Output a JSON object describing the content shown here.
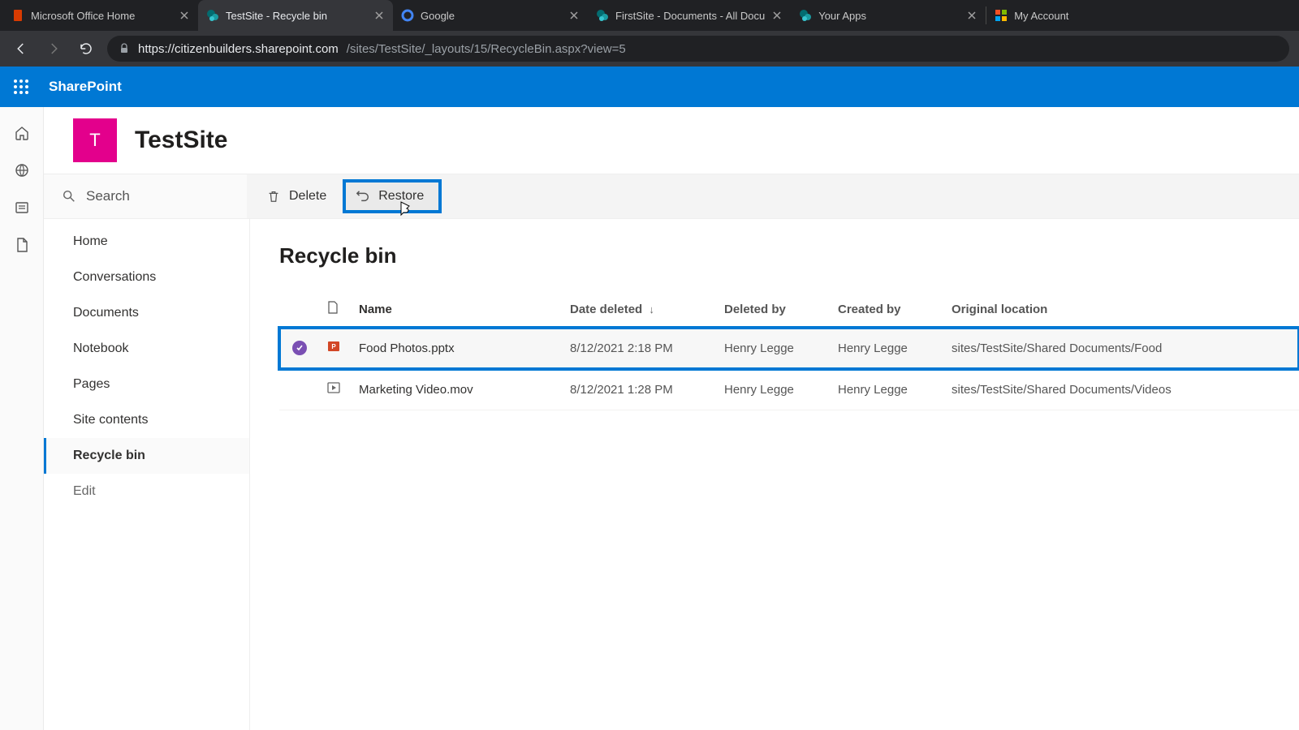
{
  "browser": {
    "tabs": [
      {
        "title": "Microsoft Office Home",
        "favicon": "office"
      },
      {
        "title": "TestSite - Recycle bin",
        "favicon": "sharepoint",
        "active": true
      },
      {
        "title": "Google",
        "favicon": "google"
      },
      {
        "title": "FirstSite - Documents - All Docu",
        "favicon": "sharepoint"
      },
      {
        "title": "Your Apps",
        "favicon": "sharepoint"
      },
      {
        "title": "My Account",
        "favicon": "microsoft"
      }
    ],
    "url_host": "https://citizenbuilders.sharepoint.com",
    "url_path": "/sites/TestSite/_layouts/15/RecycleBin.aspx?view=5"
  },
  "suite": {
    "product": "SharePoint"
  },
  "site": {
    "logo_letter": "T",
    "title": "TestSite"
  },
  "search": {
    "placeholder": "Search"
  },
  "commands": {
    "delete": "Delete",
    "restore": "Restore"
  },
  "leftnav": {
    "items": [
      "Home",
      "Conversations",
      "Documents",
      "Notebook",
      "Pages",
      "Site contents",
      "Recycle bin",
      "Edit"
    ],
    "active_index": 6
  },
  "page": {
    "title": "Recycle bin"
  },
  "table": {
    "columns": {
      "name": "Name",
      "date_deleted": "Date deleted",
      "deleted_by": "Deleted by",
      "created_by": "Created by",
      "original_location": "Original location"
    },
    "rows": [
      {
        "selected": true,
        "icon": "pptx",
        "name": "Food Photos.pptx",
        "date_deleted": "8/12/2021 2:18 PM",
        "deleted_by": "Henry Legge",
        "created_by": "Henry Legge",
        "original_location": "sites/TestSite/Shared Documents/Food"
      },
      {
        "selected": false,
        "icon": "video",
        "name": "Marketing Video.mov",
        "date_deleted": "8/12/2021 1:28 PM",
        "deleted_by": "Henry Legge",
        "created_by": "Henry Legge",
        "original_location": "sites/TestSite/Shared Documents/Videos"
      }
    ]
  }
}
